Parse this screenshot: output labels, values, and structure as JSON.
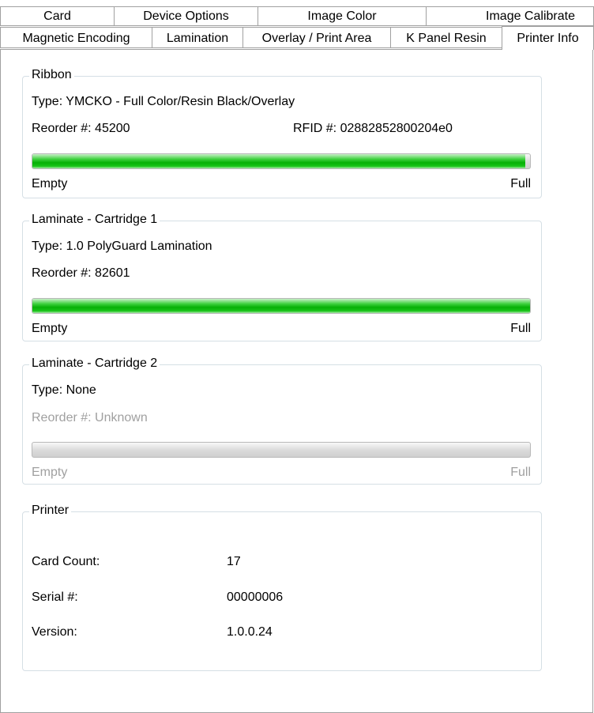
{
  "tabs_row1": [
    "Card",
    "Device Options",
    "Image Color",
    "Image Calibrate"
  ],
  "tabs_row2": [
    "Magnetic Encoding",
    "Lamination",
    "Overlay / Print Area",
    "K Panel Resin",
    "Printer Info"
  ],
  "active_tab": "Printer Info",
  "ribbon": {
    "legend": "Ribbon",
    "type": "Type: YMCKO - Full Color/Resin Black/Overlay",
    "reorder": "Reorder #: 45200",
    "rfid": "RFID #: 02882852800204e0",
    "level": 0.99,
    "empty_label": "Empty",
    "full_label": "Full"
  },
  "laminate1": {
    "legend": "Laminate - Cartridge 1",
    "type": "Type: 1.0 PolyGuard Lamination",
    "reorder": "Reorder #: 82601",
    "level": 1.0,
    "empty_label": "Empty",
    "full_label": "Full"
  },
  "laminate2": {
    "legend": "Laminate - Cartridge 2",
    "type": "Type: None",
    "reorder": "Reorder #: Unknown",
    "level": 0,
    "empty_label": "Empty",
    "full_label": "Full"
  },
  "printer": {
    "legend": "Printer",
    "card_count_label": "Card Count:",
    "card_count": "17",
    "serial_label": "Serial #:",
    "serial": "00000006",
    "version_label": "Version:",
    "version": "1.0.0.24"
  },
  "colors": {
    "bar_fill": "#06b006",
    "disabled_text": "#a0a0a0",
    "group_border": "#d5dfe5"
  }
}
